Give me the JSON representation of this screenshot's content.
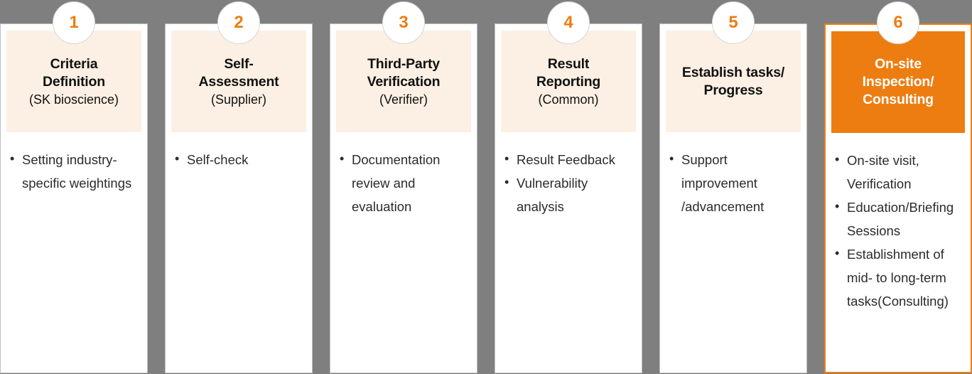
{
  "theme": {
    "background": "#7f7f7f",
    "card_background": "#ffffff",
    "header_background": "#fcf0e4",
    "accent": "#ED7D11",
    "text": "#2b2b2b"
  },
  "steps": [
    {
      "number": "1",
      "title": "Criteria Definition",
      "title_lines": [
        "Criteria",
        "Definition"
      ],
      "subtitle": "(SK bioscience)",
      "highlight": false,
      "bullets": [
        "Setting industry-specific weightings"
      ]
    },
    {
      "number": "2",
      "title": "Self-Assessment",
      "title_lines": [
        "Self-",
        "Assessment"
      ],
      "subtitle": "(Supplier)",
      "highlight": false,
      "bullets": [
        "Self-check"
      ]
    },
    {
      "number": "3",
      "title": "Third-Party Verification",
      "title_lines": [
        "Third-Party",
        "Verification"
      ],
      "subtitle": "(Verifier)",
      "highlight": false,
      "bullets": [
        "Documentation review and evaluation"
      ]
    },
    {
      "number": "4",
      "title": "Result Reporting",
      "title_lines": [
        "Result",
        "Reporting"
      ],
      "subtitle": "(Common)",
      "highlight": false,
      "bullets": [
        "Result Feedback",
        "Vulnerability analysis"
      ]
    },
    {
      "number": "5",
      "title": "Establish tasks/ Progress",
      "title_lines": [
        "Establish tasks/",
        "Progress"
      ],
      "subtitle": "",
      "highlight": false,
      "bullets": [
        "Support improvement /advancement"
      ]
    },
    {
      "number": "6",
      "title": "On-site Inspection/ Consulting",
      "title_lines": [
        "On-site",
        "Inspection/",
        "Consulting"
      ],
      "subtitle": "",
      "highlight": true,
      "bullets": [
        "On-site visit, Verification",
        "Education/Briefing Sessions",
        "Establishment of mid- to long-term tasks(Consulting)"
      ]
    }
  ]
}
